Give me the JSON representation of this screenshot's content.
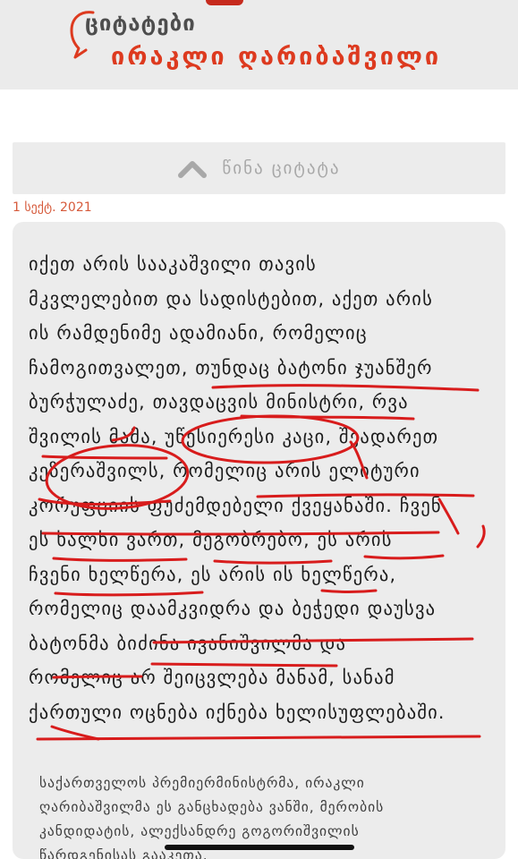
{
  "header": {
    "logo_top": "ციტატები",
    "logo_bottom": "ირაკლი ღარიბაშვილი"
  },
  "navigation": {
    "previous_quote_label": "წინა ციტატა"
  },
  "quote": {
    "date": "1 სექტ. 2021",
    "lines": [
      "იქეთ არის სააკაშვილი თავის",
      "მკვლელებით და სადისტებით, აქეთ არის",
      "ის რამდენიმე ადამიანი, რომელიც",
      "ჩამოგითვალეთ, თუნდაც ბატონი ჯუანშერ",
      "ბურჭულაძე, თავდაცვის მინისტრი, რვა",
      "შვილის მამა, უწესიერესი კაცი, შეადარეთ",
      "კეზერაშვილს, რომელიც არის ელიტური",
      "კორუფციის ფუძემდებელი ქვეყანაში. ჩვენ",
      "ეს ხალხი ვართ, მეგობრებო, ეს არის",
      "ჩვენი ხელწერა, ეს არის ის ხელწერა,",
      "რომელიც დაამკვიდრა და ბეჭედი დაუსვა",
      "ბატონმა ბიძინა ივანიშვილმა და",
      "რომელიც არ შეიცვლება მანამ, სანამ",
      "ქართული ოცნება იქნება ხელისუფლებაში."
    ],
    "source_lines": [
      "საქართველოს პრემიერმინისტრმა, ირაკლი",
      "ღარიბაშვილმა ეს განცხადება ვანში, მერობის",
      "კანდიდატის, ალექსანდრე გოგორიშვილის",
      "წარდგენისას გააკეთა."
    ]
  },
  "colors": {
    "brand_red": "#dd3a1f",
    "ink_red": "#d81c1c",
    "card_gray": "#ececec"
  }
}
